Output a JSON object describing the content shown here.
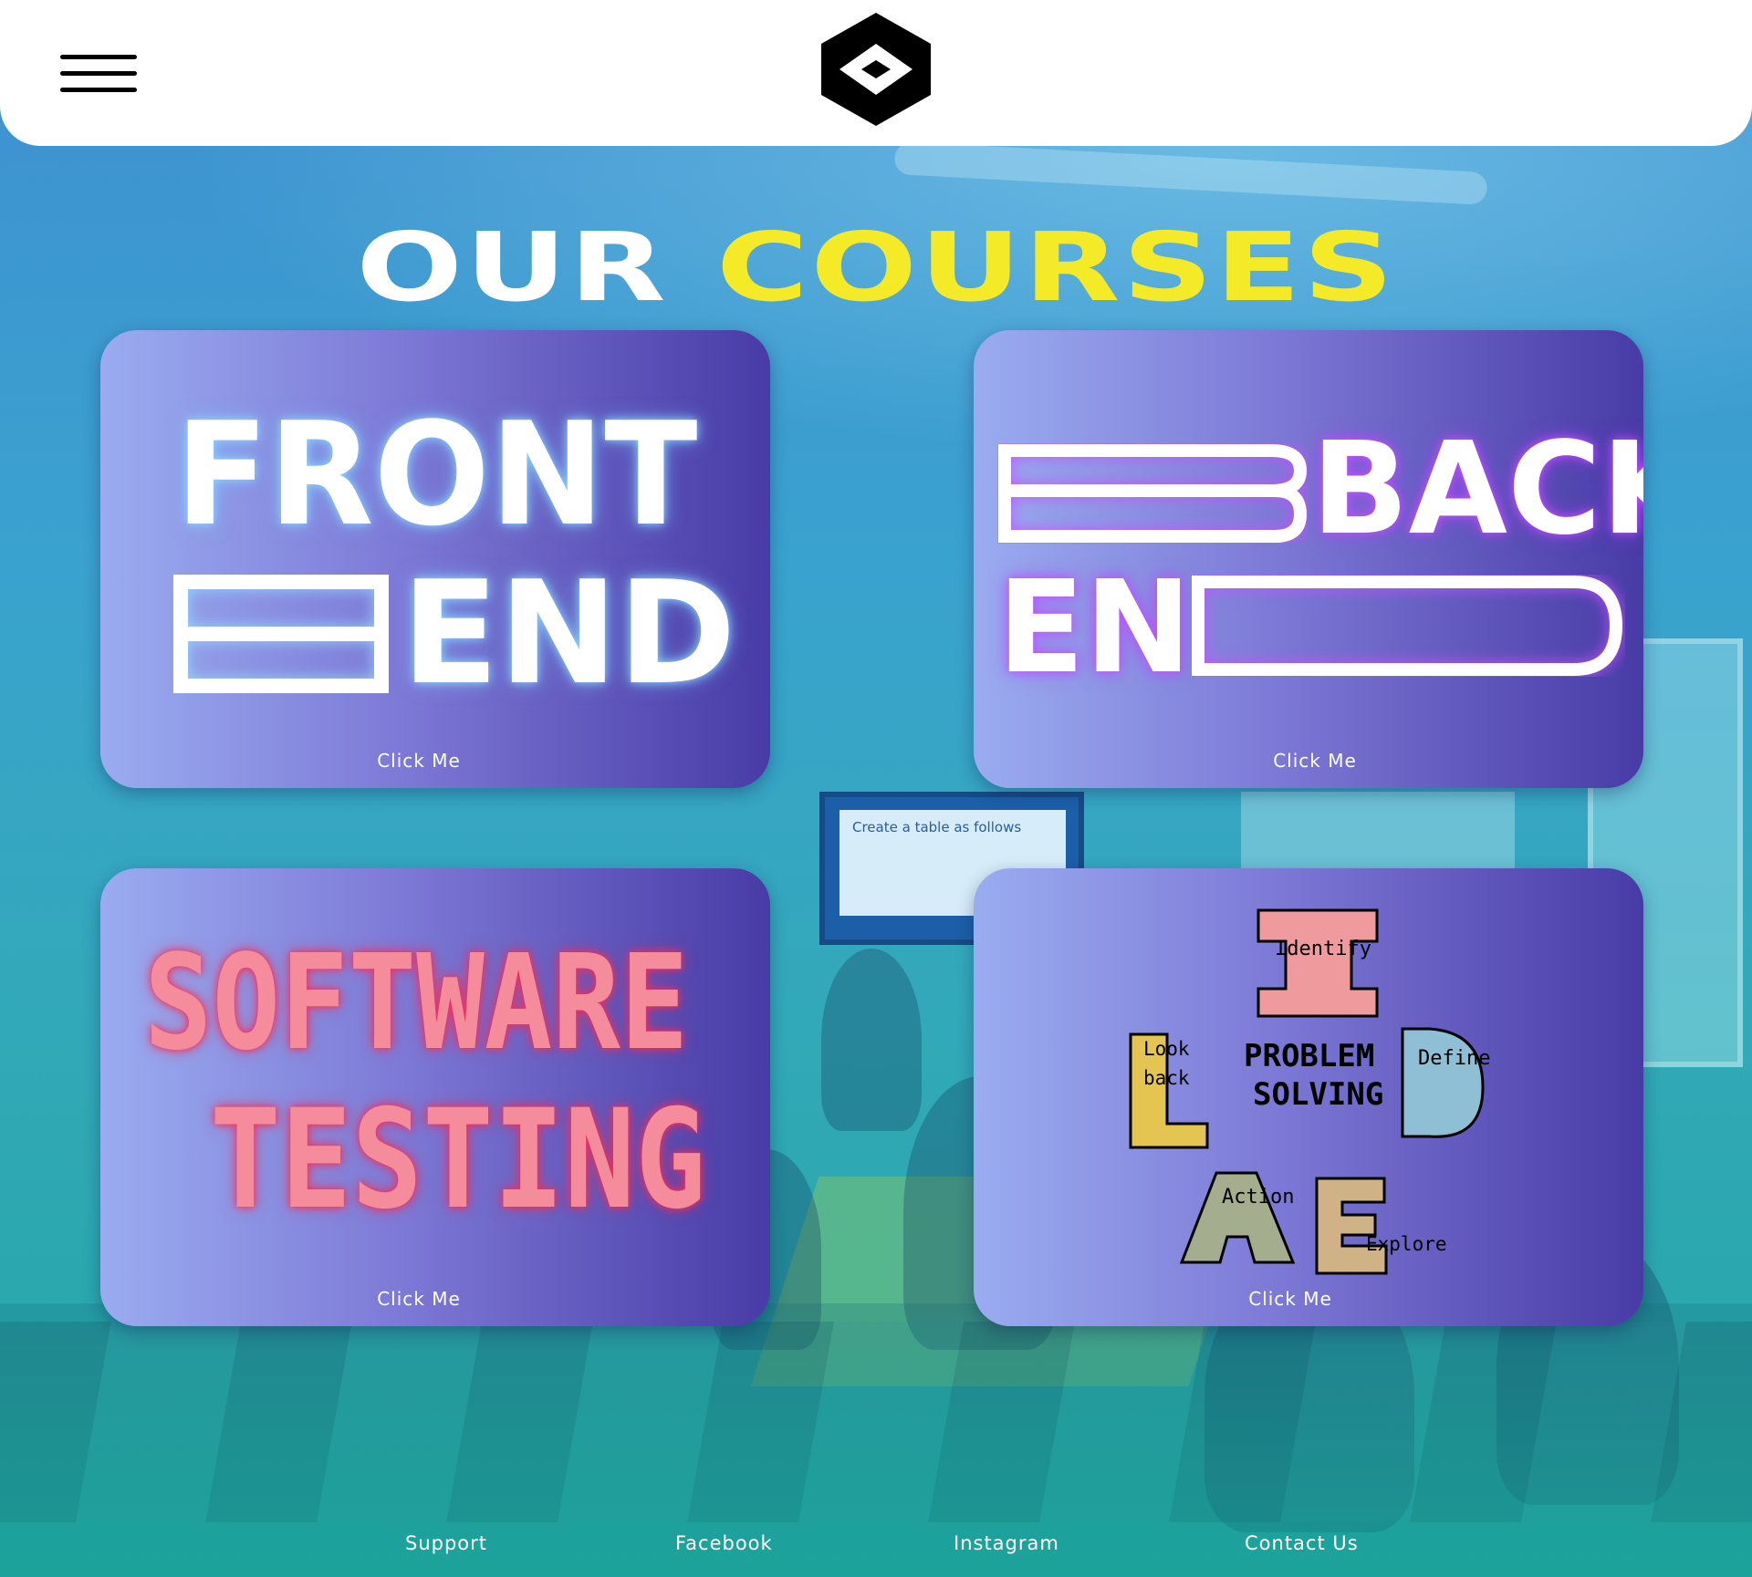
{
  "header": {
    "logo_icon": "diamond-hex-logo-icon",
    "menu_icon": "hamburger-menu-icon"
  },
  "title": {
    "word1": "OUR",
    "word2": "COURSES",
    "word1_color": "#ffffff",
    "word2_color": "#f5ea27"
  },
  "cards": [
    {
      "name": "front-end",
      "art_line1": "FRONT",
      "art_line2": "END",
      "button_label": "Click Me"
    },
    {
      "name": "back-end",
      "art_line1": "BACK",
      "art_line2": "EN",
      "button_label": "Click Me"
    },
    {
      "name": "software-testing",
      "art_line1": "SOFTWARE",
      "art_line2": "TESTING",
      "button_label": "Click Me"
    },
    {
      "name": "problem-solving",
      "art_center_line1": "PROBLEM",
      "art_center_line2": "SOLVING",
      "steps": [
        "Identify",
        "Define",
        "Explore",
        "Action",
        "Look",
        "back"
      ],
      "button_label": "Click Me"
    }
  ],
  "background": {
    "screen_text": "Create a table as follows"
  },
  "footer": {
    "links": [
      "Support",
      "Facebook",
      "Instagram",
      "Contact Us"
    ]
  },
  "colors": {
    "card_gradient_start": "#9aacf0",
    "card_gradient_end": "#483ba6",
    "accent_yellow": "#f5ea27"
  }
}
